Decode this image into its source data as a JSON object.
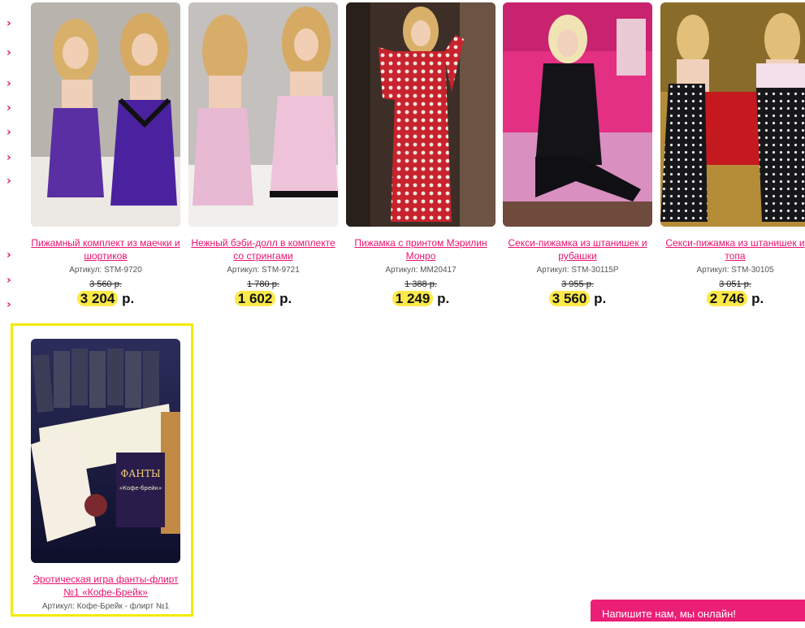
{
  "products": [
    {
      "name": "Пижамный комплект из маечки и шортиков",
      "sku": "Артикул: STM-9720",
      "old_price": "3 560 р.",
      "price": "3 204",
      "currency": "р."
    },
    {
      "name": "Нежный бэби-долл в комплекте со стрингами",
      "sku": "Артикул: STM-9721",
      "old_price": "1 780 р.",
      "price": "1 602",
      "currency": "р."
    },
    {
      "name": "Пижамка с принтом Мэрилин Монро",
      "sku": "Артикул: MM20417",
      "old_price": "1 388 р.",
      "price": "1 249",
      "currency": "р."
    },
    {
      "name": "Секси-пижамка из штанишек и рубашки",
      "sku": "Артикул: STM-30115P",
      "old_price": "3 955 р.",
      "price": "3 560",
      "currency": "р."
    },
    {
      "name": "Секси-пижамка из штанишек и топа",
      "sku": "Артикул: STM-30105",
      "old_price": "3 051 р.",
      "price": "2 746",
      "currency": "р."
    },
    {
      "name": "Эротическая игра фанты-флирт №1 «Кофе-Брейк»",
      "sku": "Артикул: Кофе-Брейк - флирт №1"
    }
  ],
  "card_game_labels": {
    "box_title": "ФАНТЫ",
    "box_subtitle": "«Кофе-брейк»"
  },
  "chat_widget": {
    "label": "Напишите нам, мы онлайн!"
  },
  "colors": {
    "accent": "#e8136f",
    "price_highlight": "#fbe94a",
    "selection_border": "#f4ea00",
    "chat_bg": "#ec1f77"
  },
  "icons": {
    "sidebar_arrow": "chevron-right-icon"
  }
}
